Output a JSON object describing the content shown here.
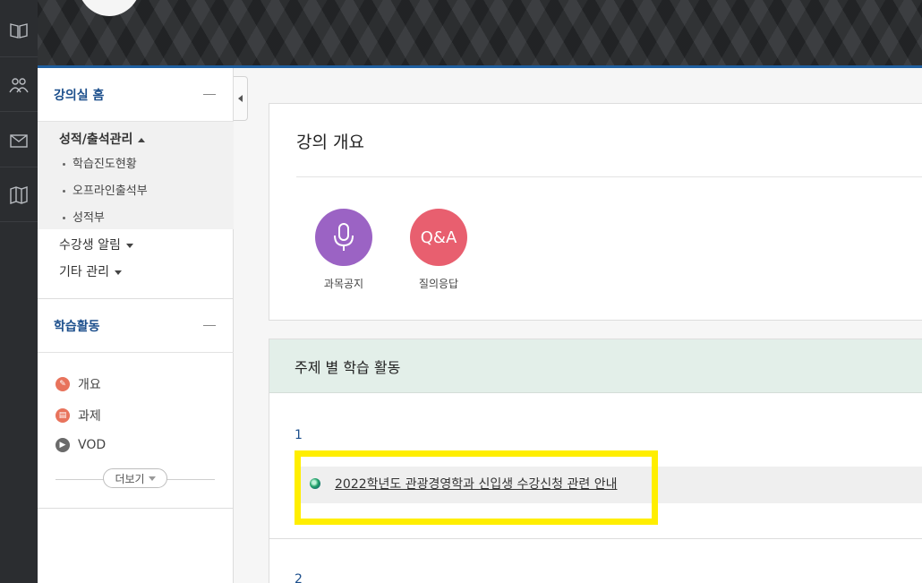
{
  "rail": {
    "items": [
      {
        "icon": "book-icon"
      },
      {
        "icon": "users-icon"
      },
      {
        "icon": "mail-icon"
      },
      {
        "icon": "map-icon"
      }
    ]
  },
  "sidebar": {
    "home_title": "강의실 홈",
    "grades_menu": {
      "title": "성적/출석관리",
      "items": [
        "학습진도현황",
        "오프라인출석부",
        "성적부"
      ]
    },
    "notify_menu": "수강생 알림",
    "etc_menu": "기타 관리",
    "activity_title": "학습활동",
    "activities": [
      {
        "label": "개요",
        "icon": "pencil-icon",
        "color": "#e8735c"
      },
      {
        "label": "과제",
        "icon": "document-icon",
        "color": "#e8735c"
      },
      {
        "label": "VOD",
        "icon": "play-icon",
        "color": "#6a6a6a"
      }
    ],
    "more_label": "더보기"
  },
  "overview": {
    "title": "강의 개요",
    "buttons": [
      {
        "label": "과목공지",
        "icon": "microphone-icon",
        "color": "#9b63c4"
      },
      {
        "label": "질의응답",
        "icon_text": "Q&A",
        "color": "#e85f6f"
      }
    ]
  },
  "topics": {
    "title": "주제 별 학습 활동",
    "week1_num": "1",
    "week1_link": "2022학년도 관광경영학과 신입생 수강신청 관련 안내",
    "week2_num": "2"
  },
  "colors": {
    "highlight": "#ffee00",
    "accent": "#1c4f8c"
  }
}
